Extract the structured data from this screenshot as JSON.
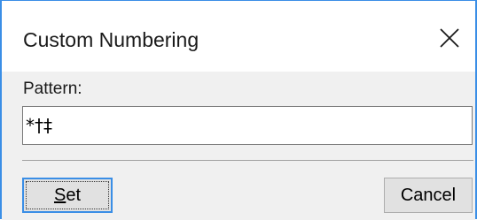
{
  "dialog": {
    "title": "Custom Numbering",
    "close_icon": "close-icon"
  },
  "pattern": {
    "label": "Pattern:",
    "value": "*†‡"
  },
  "buttons": {
    "set_accel": "S",
    "set_rest": "et",
    "cancel_label": "Cancel"
  },
  "colors": {
    "accent": "#3a8ee6",
    "dialog_bg": "#f0f0f0",
    "button_bg": "#e1e1e1"
  }
}
